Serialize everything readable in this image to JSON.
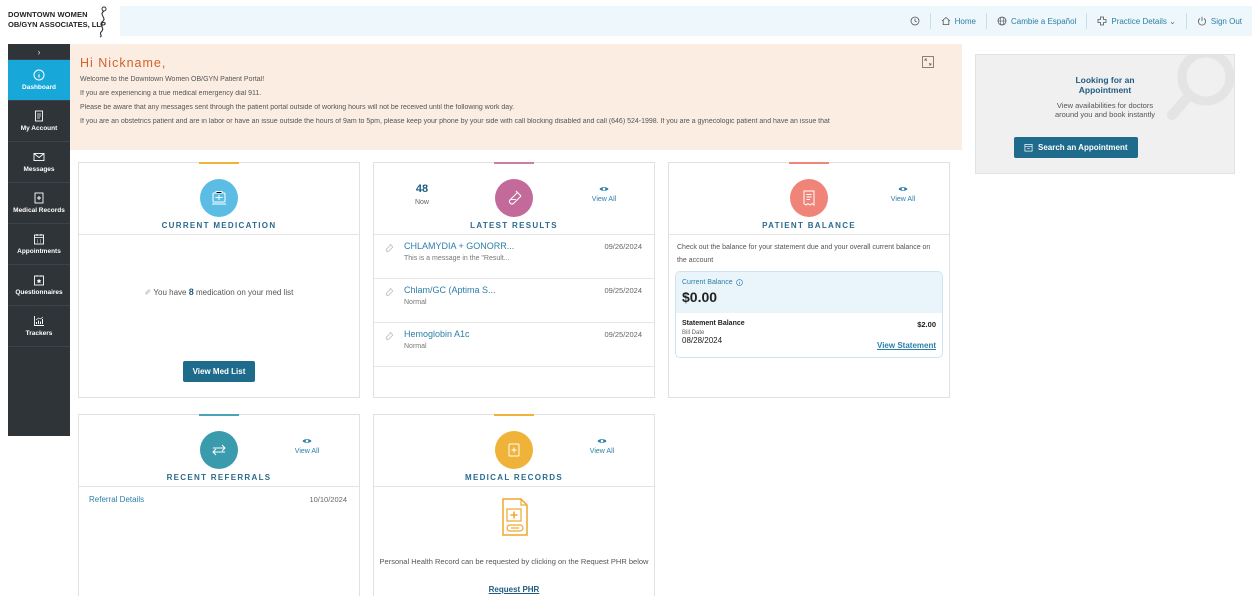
{
  "header": {
    "logo_line1": "DOWNTOWN WOMEN",
    "logo_line2": "OB/GYN ASSOCIATES, LLP",
    "nav": [
      {
        "label": "",
        "icon": "clock-icon"
      },
      {
        "label": "Home",
        "icon": "home-icon"
      },
      {
        "label": "Cambie a Español",
        "icon": "globe-icon"
      },
      {
        "label": "Practice Details ⌄",
        "icon": "medical-cross-icon"
      },
      {
        "label": "Sign Out",
        "icon": "power-icon"
      }
    ]
  },
  "sidebar": {
    "toggle": "›",
    "items": [
      {
        "label": "Dashboard",
        "icon": "info-icon",
        "active": true
      },
      {
        "label": "My Account",
        "icon": "document-icon"
      },
      {
        "label": "Messages",
        "icon": "envelope-icon"
      },
      {
        "label": "Medical Records",
        "icon": "records-icon"
      },
      {
        "label": "Appointments",
        "icon": "calendar-icon"
      },
      {
        "label": "Questionnaires",
        "icon": "questionnaire-icon"
      },
      {
        "label": "Trackers",
        "icon": "chart-icon"
      }
    ]
  },
  "banner": {
    "greeting": "Hi Nickname,",
    "lines": [
      "Welcome to the Downtown Women OB/GYN Patient Portal!",
      "If you are experiencing a true medical emergency dial 911.",
      "Please be aware that any messages sent through the patient portal outside of working hours will not be received until the following work day.",
      "If you are an obstetrics patient and are in labor or have an issue outside the hours of 9am to 5pm, please keep your phone by your side with call blocking disabled and call (646) 524-1998. If you are a gynecologic patient and have an issue that"
    ]
  },
  "medication": {
    "title": "CURRENT MEDICATION",
    "text_pre": "You have ",
    "count": "8",
    "text_post": " medication on your med list",
    "button": "View Med List",
    "accent": "#f0b339"
  },
  "results": {
    "title": "LATEST RESULTS",
    "now_count": "48",
    "now_label": "Now",
    "view_all": "View All",
    "accent": "#c77fa8",
    "rows": [
      {
        "name": "CHLAMYDIA + GONORR...",
        "sub": "This is a message in the \"Result...",
        "date": "09/26/2024"
      },
      {
        "name": "Chlam/GC (Aptima S...",
        "sub": "Normal",
        "date": "09/25/2024"
      },
      {
        "name": "Hemoglobin A1c",
        "sub": "Normal",
        "date": "09/25/2024"
      }
    ]
  },
  "balance": {
    "title": "PATIENT BALANCE",
    "view_all": "View All",
    "desc": "Check out the balance for your statement due and your overall current balance on the account",
    "current_label": "Current Balance",
    "current_amount": "$0.00",
    "statement_label": "Statement Balance",
    "statement_amount": "$2.00",
    "bill_date_label": "Bill Date",
    "bill_date": "08/28/2024",
    "view_statement": "View Statement",
    "accent": "#f08478"
  },
  "referrals": {
    "title": "RECENT REFERRALS",
    "view_all": "View All",
    "row_label": "Referral Details",
    "row_date": "10/10/2024",
    "accent": "#4aa3b8"
  },
  "records": {
    "title": "MEDICAL RECORDS",
    "view_all": "View All",
    "desc": "Personal Health Record can be requested by clicking on the Request PHR below",
    "link": "Request PHR",
    "accent": "#f0b339"
  },
  "promo": {
    "heading_line1": "Looking for an",
    "heading_line2": "Appointment",
    "desc_line1": "View availabilities for doctors",
    "desc_line2": "around you and book instantly",
    "button": "Search an Appointment"
  }
}
